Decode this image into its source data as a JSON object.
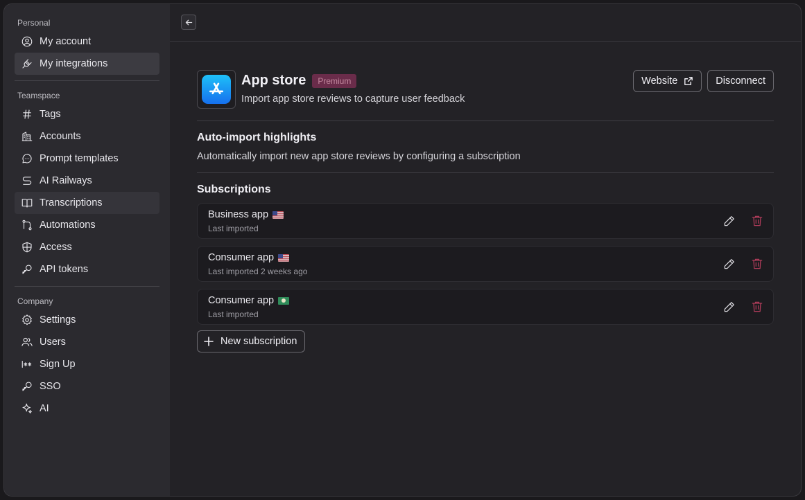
{
  "sidebar": {
    "personal_label": "Personal",
    "personal": [
      {
        "label": "My account",
        "icon": "user-circle-icon"
      },
      {
        "label": "My integrations",
        "icon": "plug-icon"
      }
    ],
    "teamspace_label": "Teamspace",
    "teamspace": [
      {
        "label": "Tags",
        "icon": "hash-icon"
      },
      {
        "label": "Accounts",
        "icon": "building-icon"
      },
      {
        "label": "Prompt templates",
        "icon": "chat-bubble-icon"
      },
      {
        "label": "AI Railways",
        "icon": "route-icon"
      },
      {
        "label": "Transcriptions",
        "icon": "book-open-icon"
      },
      {
        "label": "Automations",
        "icon": "git-branch-icon"
      },
      {
        "label": "Access",
        "icon": "shield-icon"
      },
      {
        "label": "API tokens",
        "icon": "key-icon"
      }
    ],
    "company_label": "Company",
    "company": [
      {
        "label": "Settings",
        "icon": "gear-icon"
      },
      {
        "label": "Users",
        "icon": "users-icon"
      },
      {
        "label": "Sign Up",
        "icon": "password-icon"
      },
      {
        "label": "SSO",
        "icon": "key-icon"
      },
      {
        "label": "AI",
        "icon": "sparkle-icon"
      }
    ]
  },
  "integration": {
    "title": "App store",
    "badge": "Premium",
    "subtitle": "Import app store reviews to capture user feedback",
    "website_label": "Website",
    "disconnect_label": "Disconnect"
  },
  "auto_import": {
    "title": "Auto-import highlights",
    "description": "Automatically import new app store reviews by configuring a subscription"
  },
  "subscriptions": {
    "title": "Subscriptions",
    "items": [
      {
        "name": "Business app",
        "flag": "us-flag",
        "meta": "Last imported"
      },
      {
        "name": "Consumer app",
        "flag": "us-flag",
        "meta": "Last imported 2 weeks ago"
      },
      {
        "name": "Consumer app",
        "flag": "green-flag",
        "meta": "Last imported"
      }
    ],
    "new_label": "New subscription"
  },
  "colors": {
    "badge_bg": "#6a2c4a",
    "delete": "#b03c5a",
    "app_icon_top": "#1ec0f8",
    "app_icon_bottom": "#1670ee"
  }
}
